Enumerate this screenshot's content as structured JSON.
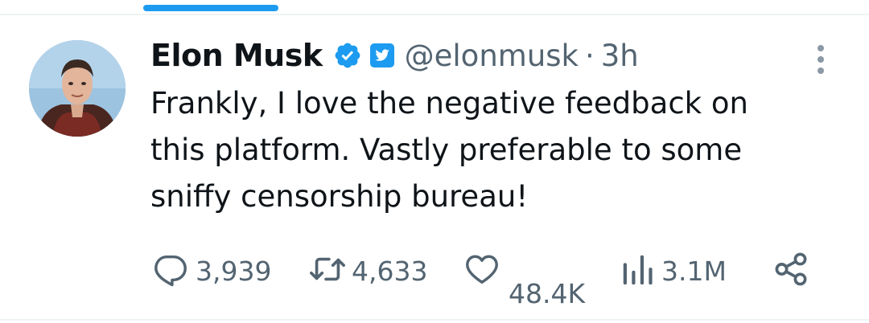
{
  "tweet": {
    "author": {
      "name": "Elon Musk",
      "handle": "@elonmusk",
      "separator": "·",
      "time": "3h",
      "verified_color": "#1d9bf0"
    },
    "text_lines": [
      "Frankly, I love the negative feedback on",
      "this platform. Vastly preferable to some",
      "sniffy censorship bureau!"
    ],
    "stats": {
      "replies": "3,939",
      "retweets": "4,633",
      "likes": "48.4K",
      "views": "3.1M"
    }
  },
  "icons": {
    "verified": "verified-badge-icon",
    "affiliate": "twitter-bird-badge-icon",
    "more": "more-vertical-icon",
    "reply": "reply-bubble-icon",
    "retweet": "retweet-icon",
    "like": "heart-icon",
    "views": "views-bar-chart-icon",
    "share": "share-icon"
  },
  "colors": {
    "accent": "#1d9bf0",
    "text": "#0f1419",
    "muted": "#536471"
  }
}
